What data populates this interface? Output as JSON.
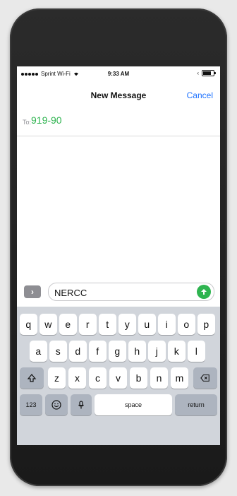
{
  "status": {
    "carrier": "Sprint Wi-Fi",
    "time": "9:33 AM"
  },
  "nav": {
    "title": "New Message",
    "cancel": "Cancel"
  },
  "to": {
    "label": "To:",
    "value": "919-90"
  },
  "compose": {
    "text": "NERCC"
  },
  "keyboard": {
    "row1": [
      "q",
      "w",
      "e",
      "r",
      "t",
      "y",
      "u",
      "i",
      "o",
      "p"
    ],
    "row2": [
      "a",
      "s",
      "d",
      "f",
      "g",
      "h",
      "j",
      "k",
      "l"
    ],
    "row3": [
      "z",
      "x",
      "c",
      "v",
      "b",
      "n",
      "m"
    ],
    "numbers": "123",
    "space": "space",
    "return": "return"
  },
  "icons": {
    "wifi": "wifi-icon",
    "battery": "battery-icon",
    "send": "send-icon",
    "expand": "expand-icon",
    "shift": "shift-icon",
    "delete": "delete-icon",
    "emoji": "emoji-icon",
    "mic": "microphone-icon"
  },
  "colors": {
    "accent_green": "#2fb450",
    "link_blue": "#1f73ff"
  }
}
